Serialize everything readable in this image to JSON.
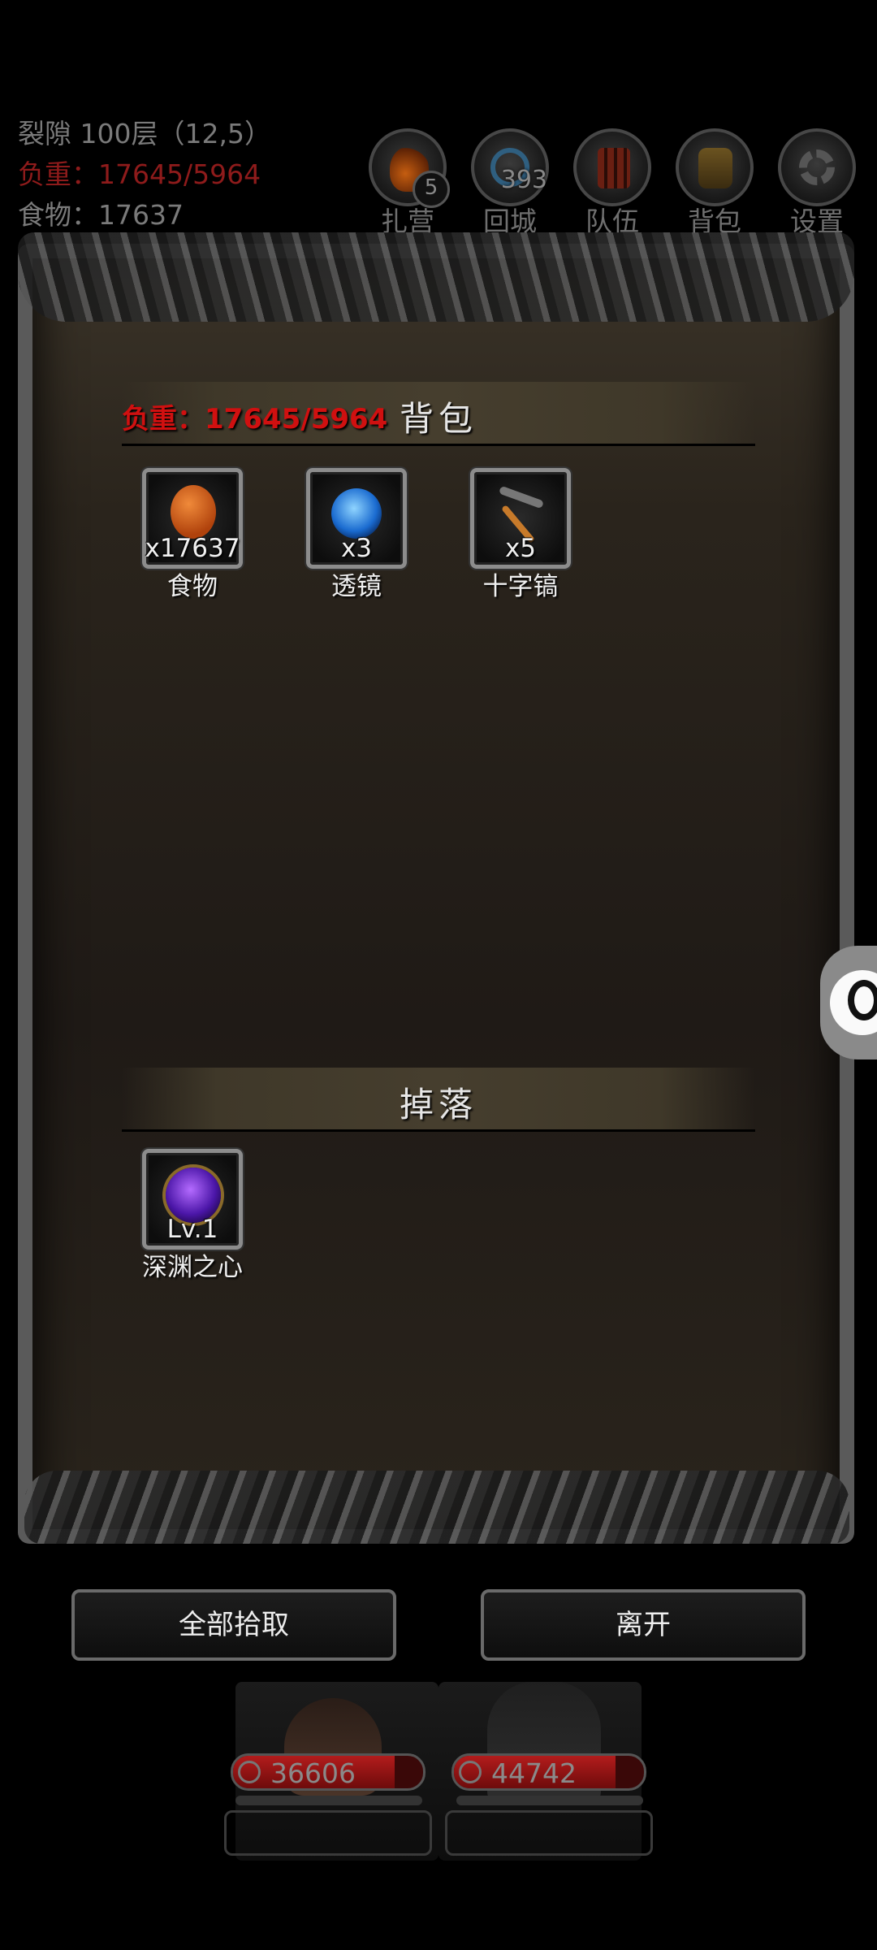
{
  "hud": {
    "location": "裂隙 100层（12,5）",
    "load": "负重：17645/5964",
    "food": "食物：17637"
  },
  "top_buttons": [
    {
      "label": "扎营",
      "icon": "campfire-icon",
      "badge": "5"
    },
    {
      "label": "回城",
      "icon": "portal-icon",
      "count": "393"
    },
    {
      "label": "队伍",
      "icon": "team-icon"
    },
    {
      "label": "背包",
      "icon": "backpack-icon"
    },
    {
      "label": "设置",
      "icon": "gear-icon"
    }
  ],
  "inventory": {
    "title": "背包",
    "load": "负重：17645/5964",
    "items": [
      {
        "name": "食物",
        "qty": "x17637",
        "icon": "meat-icon"
      },
      {
        "name": "透镜",
        "qty": "x3",
        "icon": "lens-orb-icon"
      },
      {
        "name": "十字镐",
        "qty": "x5",
        "icon": "pickaxe-icon"
      }
    ]
  },
  "drops": {
    "title": "掉落",
    "items": [
      {
        "name": "深渊之心",
        "qty": "Lv.1",
        "icon": "abyss-heart-icon"
      }
    ]
  },
  "actions": {
    "pickup_all": "全部拾取",
    "leave": "离开"
  },
  "heroes": [
    {
      "hp": "36606",
      "hp_fraction": 0.85
    },
    {
      "hp": "44742",
      "hp_fraction": 0.85
    }
  ],
  "colors": {
    "load_red": "#d01010",
    "hp_red": "#b31c1c",
    "frame_gray": "#5a5a5a"
  }
}
